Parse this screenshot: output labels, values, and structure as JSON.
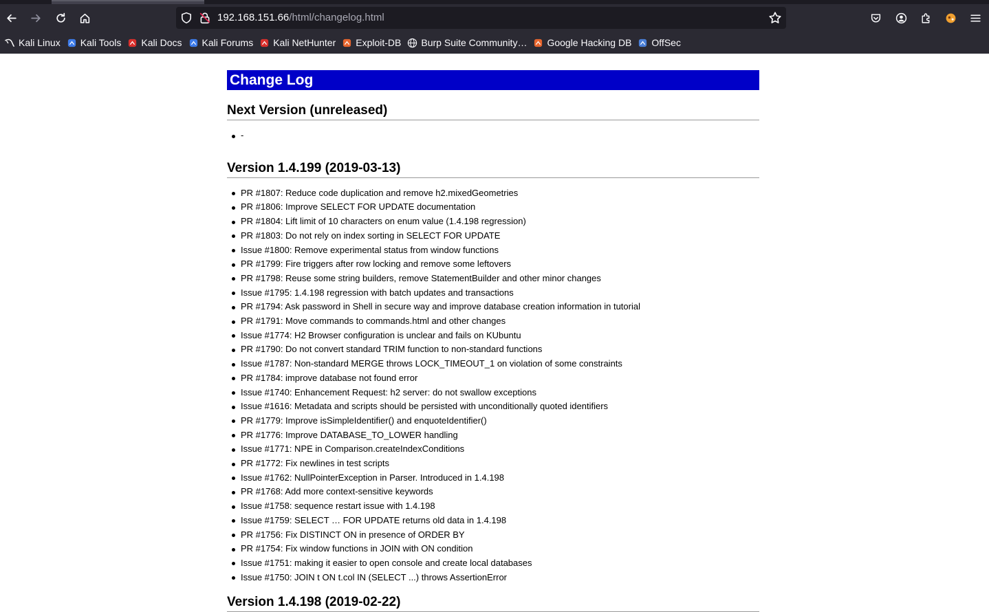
{
  "browser": {
    "url_host": "192.168.151.66",
    "url_path": "/html/changelog.html",
    "bookmarks": [
      {
        "label": "Kali Linux",
        "icon": "kali-dragon-icon",
        "color": "#ffffff"
      },
      {
        "label": "Kali Tools",
        "icon": "kali-tools-icon",
        "color": "#3d7be8"
      },
      {
        "label": "Kali Docs",
        "icon": "kali-docs-icon",
        "color": "#d9302c"
      },
      {
        "label": "Kali Forums",
        "icon": "kali-forums-icon",
        "color": "#3d7be8"
      },
      {
        "label": "Kali NetHunter",
        "icon": "kali-nethunter-icon",
        "color": "#d9302c"
      },
      {
        "label": "Exploit-DB",
        "icon": "exploit-db-icon",
        "color": "#e8662e"
      },
      {
        "label": "Burp Suite Community…",
        "icon": "globe-icon",
        "color": "#fbfbfe"
      },
      {
        "label": "Google Hacking DB",
        "icon": "ghdb-icon",
        "color": "#e8662e"
      },
      {
        "label": "OffSec",
        "icon": "offsec-icon",
        "color": "#4a7fd6"
      }
    ]
  },
  "page": {
    "title": "Change Log",
    "sections": {
      "next": {
        "heading": "Next Version (unreleased)",
        "items": [
          "-"
        ]
      },
      "v199": {
        "heading": "Version 1.4.199 (2019-03-13)",
        "items": [
          "PR #1807: Reduce code duplication and remove h2.mixedGeometries",
          "PR #1806: Improve SELECT FOR UPDATE documentation",
          "PR #1804: Lift limit of 10 characters on enum value (1.4.198 regression)",
          "PR #1803: Do not rely on index sorting in SELECT FOR UPDATE",
          "Issue #1800: Remove experimental status from window functions",
          "PR #1799: Fire triggers after row locking and remove some leftovers",
          "PR #1798: Reuse some string builders, remove StatementBuilder and other minor changes",
          "Issue #1795: 1.4.198 regression with batch updates and transactions",
          "PR #1794: Ask password in Shell in secure way and improve database creation information in tutorial",
          "PR #1791: Move commands to commands.html and other changes",
          "Issue #1774: H2 Browser configuration is unclear and fails on KUbuntu",
          "PR #1790: Do not convert standard TRIM function to non-standard functions",
          "Issue #1787: Non-standard MERGE throws LOCK_TIMEOUT_1 on violation of some constraints",
          "PR #1784: improve database not found error",
          "Issue #1740: Enhancement Request: h2 server: do not swallow exceptions",
          "Issue #1616: Metadata and scripts should be persisted with unconditionally quoted identifiers",
          "PR #1779: Improve isSimpleIdentifier() and enquoteIdentifier()",
          "PR #1776: Improve DATABASE_TO_LOWER handling",
          "Issue #1771: NPE in Comparison.createIndexConditions",
          "PR #1772: Fix newlines in test scripts",
          "Issue #1762: NullPointerException in Parser. Introduced in 1.4.198",
          "PR #1768: Add more context-sensitive keywords",
          "Issue #1758: sequence restart issue with 1.4.198",
          "Issue #1759: SELECT … FOR UPDATE returns old data in 1.4.198",
          "PR #1756: Fix DISTINCT ON in presence of ORDER BY",
          "PR #1754: Fix window functions in JOIN with ON condition",
          "Issue #1751: making it easier to open console and create local databases",
          "Issue #1750: JOIN t ON t.col IN (SELECT ...) throws AssertionError"
        ]
      },
      "v198": {
        "heading": "Version 1.4.198 (2019-02-22)"
      }
    }
  }
}
